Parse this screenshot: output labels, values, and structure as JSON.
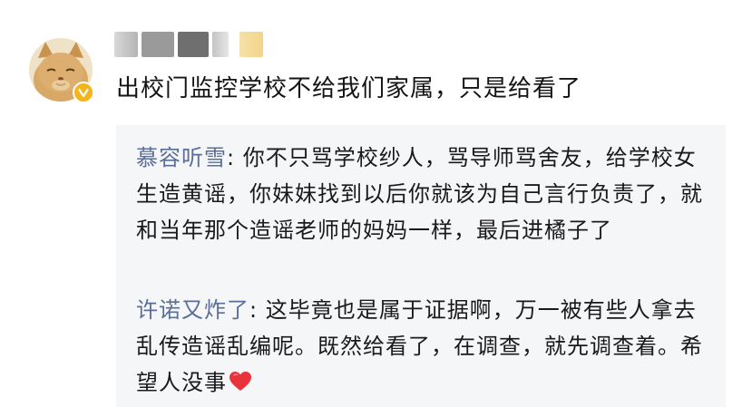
{
  "comment": {
    "text": "出校门监控学校不给我们家属，只是给看了",
    "avatar_icon": "cat-avatar-icon",
    "badge_icon": "verified-v-icon",
    "badge_color": "#f4b41a"
  },
  "replies": [
    {
      "author": "慕容听雪",
      "separator": ": ",
      "text": "你不只骂学校纱人，骂导师骂舍友，给学校女生造黄谣，你妹妹找到以后你就该为自己言行负责了，就和当年那个造谣老师的妈妈一样，最后进橘子了"
    },
    {
      "author": "许诺又炸了",
      "separator": ": ",
      "text": "这毕竟也是属于证据啊，万一被有些人拿去乱传造谣乱编呢。既然给看了，在调查，就先调查着。希望人没事",
      "trailing_icon": "red-heart-icon"
    }
  ],
  "colors": {
    "author_link": "#5a6e96",
    "reply_background": "#f5f6f8",
    "heart": "#e8333b"
  }
}
